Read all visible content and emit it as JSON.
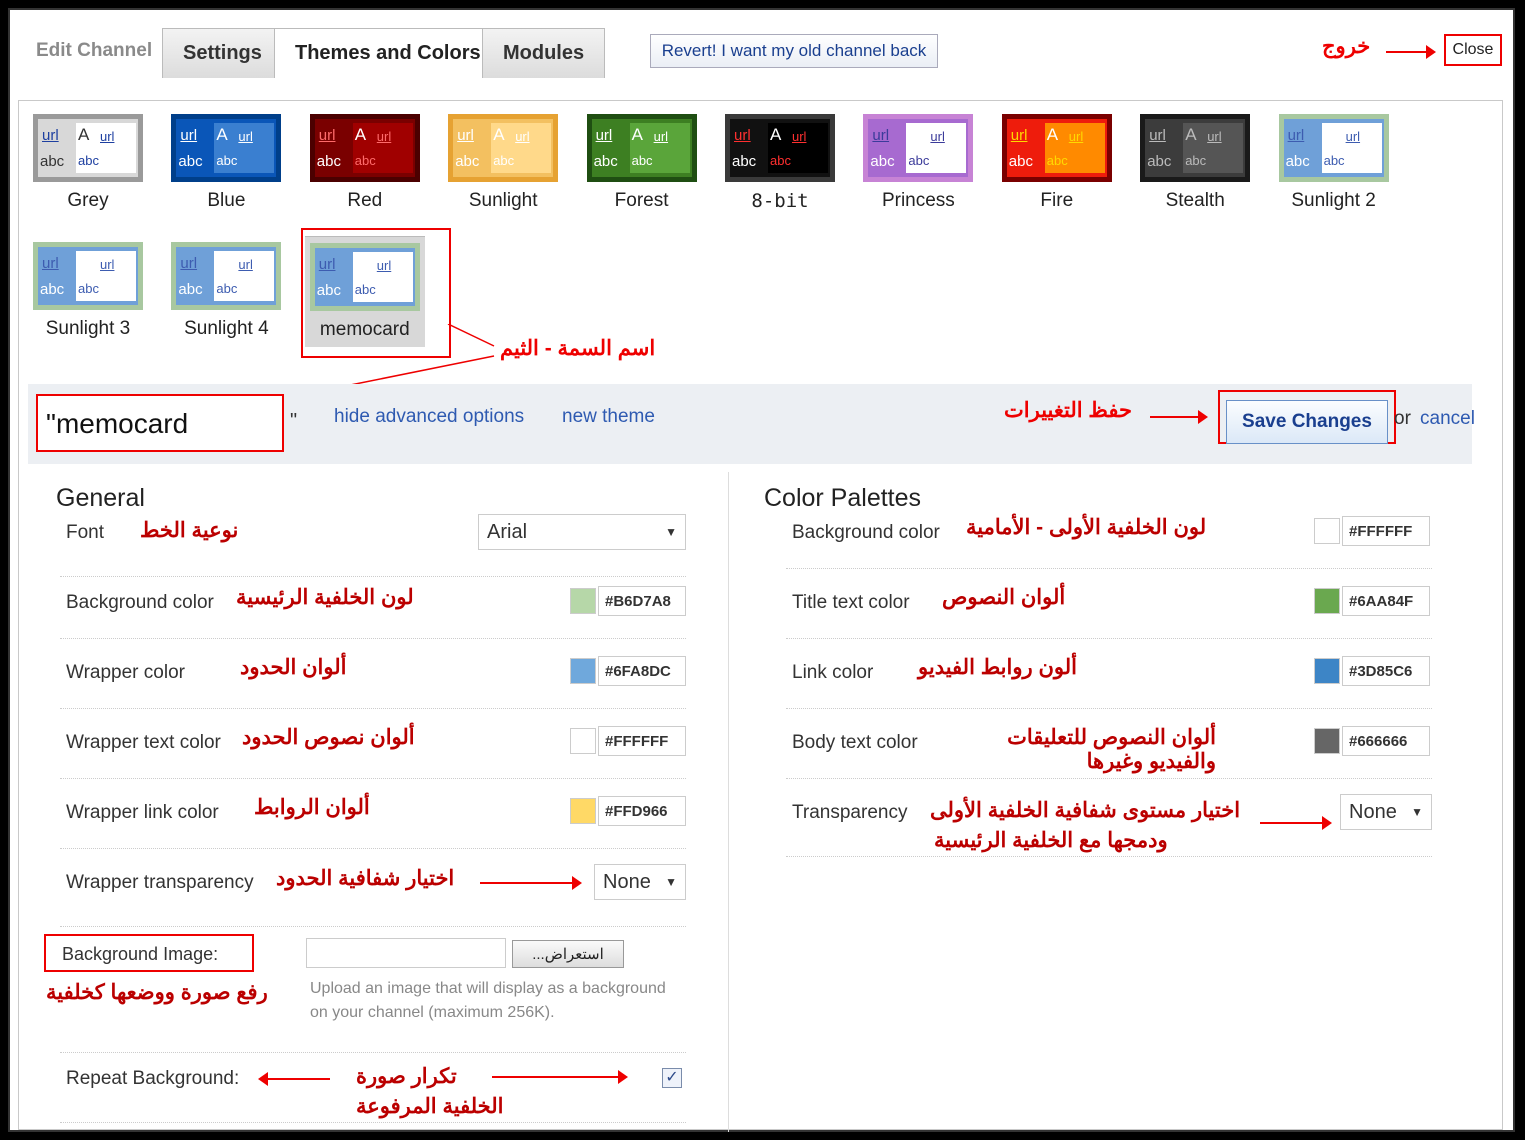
{
  "tabs": {
    "edit_label": "Edit Channel",
    "settings": "Settings",
    "themes": "Themes and Colors",
    "modules": "Modules"
  },
  "revert_label": "Revert! I want my old channel back",
  "close_label": "Close",
  "close_annotation": "خروج",
  "themes": [
    {
      "name": "Grey",
      "border": "#9a9a9a",
      "bg": "#d8d8d8",
      "inner": "#ffffff",
      "link": "#1d3fa0",
      "text": "#333333"
    },
    {
      "name": "Blue",
      "border": "#003f8a",
      "bg": "#0a56b8",
      "inner": "#3a7fd0",
      "link": "#ffffff",
      "text": "#ffffff"
    },
    {
      "name": "Red",
      "border": "#4b0000",
      "bg": "#7a0000",
      "inner": "#a00000",
      "link": "#ff6b6b",
      "text": "#ffffff"
    },
    {
      "name": "Sunlight",
      "border": "#e6a232",
      "bg": "#f3c060",
      "inner": "#ffd98a",
      "link": "#ffffff",
      "text": "#ffffff"
    },
    {
      "name": "Forest",
      "border": "#1f4e12",
      "bg": "#3d7f22",
      "inner": "#5aa53a",
      "link": "#ffffff",
      "text": "#ffffff"
    },
    {
      "name": "8-bit",
      "border": "#3a3a3a",
      "bg": "#111111",
      "inner": "#000000",
      "link": "#ff3030",
      "text": "#ffffff"
    },
    {
      "name": "Princess",
      "border": "#c783d5",
      "bg": "#a76ad0",
      "inner": "#ffffff",
      "link": "#3b3b9a",
      "text": "#ffffff"
    },
    {
      "name": "Fire",
      "border": "#7a0000",
      "bg": "#ee1c0c",
      "inner": "#ff8a00",
      "link": "#ffd900",
      "text": "#ffffff"
    },
    {
      "name": "Stealth",
      "border": "#1a1a1a",
      "bg": "#3c3c3c",
      "inner": "#555555",
      "link": "#bbbbbb",
      "text": "#bbbbbb"
    },
    {
      "name": "Sunlight 2",
      "border": "#a8c8a0",
      "bg": "#6fa0d8",
      "inner": "#ffffff",
      "link": "#3d5cb0",
      "text": "#ffffff"
    },
    {
      "name": "Sunlight 3",
      "border": "#a8c8a0",
      "bg": "#6fa0d8",
      "inner": "#ffffff",
      "link": "#3d5cb0",
      "text": "#ffffff"
    },
    {
      "name": "Sunlight 4",
      "border": "#a8c8a0",
      "bg": "#6fa0d8",
      "inner": "#ffffff",
      "link": "#3d5cb0",
      "text": "#ffffff"
    },
    {
      "name": "memocard",
      "border": "#a8c8a0",
      "bg": "#6fa0d8",
      "inner": "#ffffff",
      "link": "#3d5cb0",
      "text": "#ffffff"
    }
  ],
  "swatch_text": {
    "url": "url",
    "a": "A",
    "abc": "abc"
  },
  "theme_name_annotation": "اسم السمة - الثيم",
  "theme_name_value": "\"memocard",
  "quote_mark": "\"",
  "hide_advanced": "hide advanced options",
  "new_theme": "new theme",
  "save_annotation": "حفظ التغييرات",
  "save_label": "Save Changes",
  "or_text": "or",
  "cancel_label": "cancel",
  "general": {
    "title": "General",
    "font_label": "Font",
    "font_annotation": "نوعية الخط",
    "font_value": "Arial",
    "rows": [
      {
        "label": "Background color",
        "annotation": "لون الخلفية الرئيسية",
        "hex": "#B6D7A8",
        "color": "#b6d7a8"
      },
      {
        "label": "Wrapper color",
        "annotation": "ألوان الحدود",
        "hex": "#6FA8DC",
        "color": "#6fa8dc"
      },
      {
        "label": "Wrapper text color",
        "annotation": "ألوان نصوص الحدود",
        "hex": "#FFFFFF",
        "color": "#ffffff"
      },
      {
        "label": "Wrapper link color",
        "annotation": "ألوان الروابط",
        "hex": "#FFD966",
        "color": "#ffd966"
      }
    ],
    "transparency_label": "Wrapper transparency",
    "transparency_annotation": "اختيار شفافية الحدود",
    "transparency_value": "None",
    "bg_image_label": "Background Image:",
    "bg_image_annotation": "رفع صورة ووضعها كخلفية",
    "browse_label": "...استعراض",
    "upload_help_1": "Upload an image that will display as a background",
    "upload_help_2": "on your channel (maximum 256K).",
    "repeat_label": "Repeat Background:",
    "repeat_annotation_1": "تكرار صورة",
    "repeat_annotation_2": "الخلفية المرفوعة",
    "repeat_checked": true
  },
  "palettes": {
    "title": "Color Palettes",
    "rows": [
      {
        "label": "Background color",
        "annotation": "لون الخلفية الأولى - الأمامية",
        "hex": "#FFFFFF",
        "color": "#ffffff"
      },
      {
        "label": "Title text color",
        "annotation": "ألوان النصوص",
        "hex": "#6AA84F",
        "color": "#6aa84f"
      },
      {
        "label": "Link color",
        "annotation": "ألون روابط الفيديو",
        "hex": "#3D85C6",
        "color": "#3d85c6"
      },
      {
        "label": "Body text color",
        "annotation": "ألوان النصوص للتعليقات والفيديو وغيرها",
        "hex": "#666666",
        "color": "#666666"
      }
    ],
    "transparency_label": "Transparency",
    "transparency_annotation_1": "اختيار مستوى شفافية الخلفية الأولى",
    "transparency_annotation_2": "ودمجها مع الخلفية الرئيسية",
    "transparency_value": "None"
  }
}
